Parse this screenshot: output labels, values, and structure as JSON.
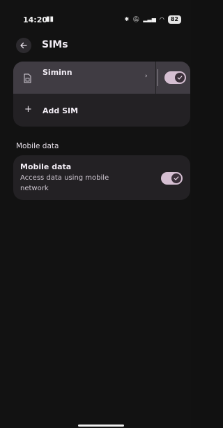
{
  "status_bar": {
    "time": "14:20",
    "battery": "82"
  },
  "header": {
    "title": "SIMs"
  },
  "sims": {
    "items": [
      {
        "label": "Siminn",
        "enabled": true
      }
    ],
    "add_label": "Add SIM"
  },
  "mobile_data_section": {
    "header": "Mobile data",
    "item": {
      "title": "Mobile data",
      "subtitle": "Access data using mobile network",
      "enabled": true
    }
  },
  "colors": {
    "background": "#121212",
    "card": "#232124",
    "highlight_row": "#403c43",
    "toggle_track": "#d5bfd2",
    "toggle_knob": "#3a2f39"
  }
}
